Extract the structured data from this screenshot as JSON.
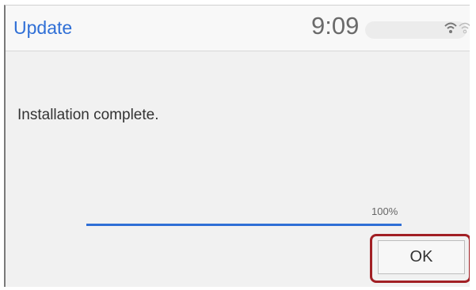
{
  "header": {
    "title": "Update",
    "clock": "9:09",
    "icons": [
      "wifi-icon",
      "wifi-secondary-icon"
    ]
  },
  "main": {
    "message": "Installation complete.",
    "progress": {
      "label": "100%",
      "value": 1.0
    }
  },
  "actions": {
    "ok_label": "OK"
  },
  "colors": {
    "accent": "#2f6fd6",
    "background": "#f1f1f1",
    "highlight": "#a11f24"
  }
}
